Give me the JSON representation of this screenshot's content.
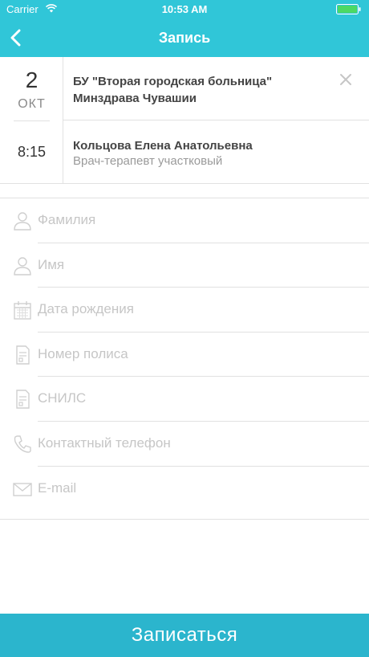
{
  "status_bar": {
    "carrier": "Carrier",
    "time": "10:53 AM"
  },
  "nav": {
    "title": "Запись",
    "back_icon": "chevron-left-icon"
  },
  "appointment": {
    "day": "2",
    "month": "ОКТ",
    "time": "8:15",
    "hospital": "БУ \"Вторая городская больница\" Минздрава Чувашии",
    "doctor_name": "Кольцова Елена Анатольевна",
    "doctor_role": "Врач-терапевт участковый"
  },
  "form": {
    "fields": [
      {
        "placeholder": "Фамилия",
        "icon": "person-icon"
      },
      {
        "placeholder": "Имя",
        "icon": "person-icon"
      },
      {
        "placeholder": "Дата рождения",
        "icon": "calendar-icon"
      },
      {
        "placeholder": "Номер полиса",
        "icon": "document-icon"
      },
      {
        "placeholder": "СНИЛС",
        "icon": "document-icon"
      },
      {
        "placeholder": "Контактный телефон",
        "icon": "phone-icon"
      },
      {
        "placeholder": "E-mail",
        "icon": "mail-icon"
      }
    ]
  },
  "submit_label": "Записаться",
  "colors": {
    "accent": "#30c6d8",
    "button": "#2bb5cd",
    "separator": "#e1e1e1",
    "placeholder": "#c6c6c6"
  }
}
